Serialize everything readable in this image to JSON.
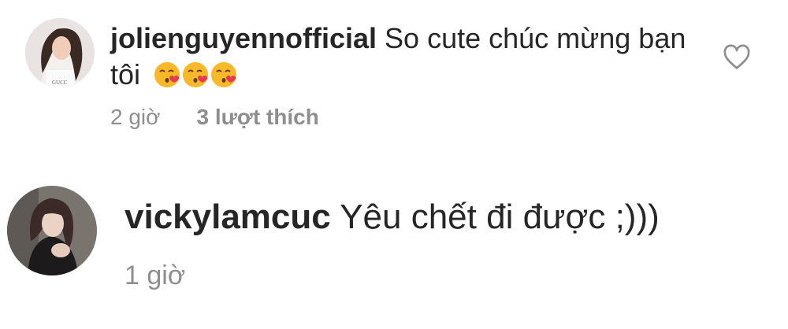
{
  "comments": [
    {
      "username": "jolienguyennofficial",
      "text": "So cute chúc mừng bạn tôi",
      "emojis": [
        "kissing-face-icon",
        "kissing-face-icon",
        "kissing-face-icon"
      ],
      "time": "2 giờ",
      "likes": "3 lượt thích"
    },
    {
      "username": "vickylamcuc",
      "text": "Yêu chết đi được ;)))",
      "time": "1 giờ"
    }
  ],
  "colors": {
    "text": "#262626",
    "muted": "#8e8e8e",
    "emoji": "#f7b82a"
  }
}
